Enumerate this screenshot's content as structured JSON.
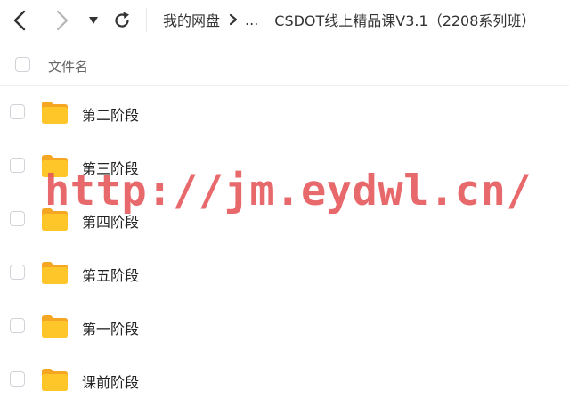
{
  "toolbar": {
    "back_icon": "chevron-left-icon",
    "forward_icon": "chevron-right-icon",
    "menu_icon": "caret-down-icon",
    "refresh_icon": "refresh-icon"
  },
  "breadcrumb": {
    "root": "我的网盘",
    "separator": ">",
    "ellipsis": "...",
    "current": "CSDOT线上精品课V3.1（2208系列班）"
  },
  "list_header": {
    "column_name": "文件名"
  },
  "files": [
    {
      "name": "第二阶段",
      "type": "folder"
    },
    {
      "name": "第三阶段",
      "type": "folder"
    },
    {
      "name": "第四阶段",
      "type": "folder"
    },
    {
      "name": "第五阶段",
      "type": "folder"
    },
    {
      "name": "第一阶段",
      "type": "folder"
    },
    {
      "name": "课前阶段",
      "type": "folder"
    }
  ],
  "watermark": {
    "text": "http://jm.eydwl.cn/"
  },
  "colors": {
    "folder": "#FFC629",
    "folder_dark": "#F5A623",
    "watermark": "#E45458",
    "text": "#222222",
    "muted": "#666666"
  }
}
